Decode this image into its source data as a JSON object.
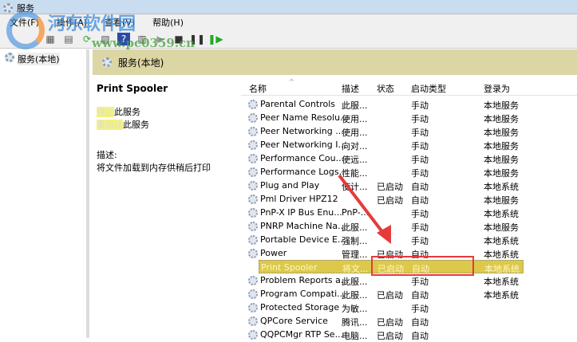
{
  "window": {
    "title": "服务"
  },
  "menu": [
    "文件(F)",
    "操作(A)",
    "查看(V)",
    "帮助(H)"
  ],
  "tree": {
    "item": "服务(本地)"
  },
  "band": {
    "title": "服务(本地)"
  },
  "details": {
    "service_name": "Print Spooler",
    "stop_link": "停止",
    "restart_link": "重启动",
    "link_suffix": "此服务",
    "desc_label": "描述:",
    "desc": "将文件加载到内存供稍后打印"
  },
  "columns": [
    "名称",
    "描述",
    "状态",
    "启动类型",
    "登录为"
  ],
  "rows": [
    [
      "Parental Controls",
      "此服...",
      "",
      "手动",
      "本地服务"
    ],
    [
      "Peer Name Resolu...",
      "使用...",
      "",
      "手动",
      "本地服务"
    ],
    [
      "Peer Networking ...",
      "使用...",
      "",
      "手动",
      "本地服务"
    ],
    [
      "Peer Networking I...",
      "向对...",
      "",
      "手动",
      "本地服务"
    ],
    [
      "Performance Cou...",
      "使远...",
      "",
      "手动",
      "本地服务"
    ],
    [
      "Performance Logs...",
      "性能...",
      "",
      "手动",
      "本地服务"
    ],
    [
      "Plug and Play",
      "使计...",
      "已启动",
      "自动",
      "本地系统"
    ],
    [
      "Pml Driver HPZ12",
      "",
      "已启动",
      "自动",
      "本地服务"
    ],
    [
      "PnP-X IP Bus Enu...",
      "PnP-...",
      "",
      "手动",
      "本地系统"
    ],
    [
      "PNRP Machine Na...",
      "此服...",
      "",
      "手动",
      "本地服务"
    ],
    [
      "Portable Device E...",
      "强制...",
      "",
      "手动",
      "本地系统"
    ],
    [
      "Power",
      "管理...",
      "已启动",
      "自动",
      "本地系统"
    ],
    [
      "Print Spooler",
      "将文...",
      "已启动",
      "自动",
      "本地系统"
    ],
    [
      "Problem Reports a...",
      "此服...",
      "",
      "手动",
      "本地系统"
    ],
    [
      "Program Compati...",
      "此服...",
      "已启动",
      "自动",
      "本地系统"
    ],
    [
      "Protected Storage",
      "为敏...",
      "",
      "手动",
      ""
    ],
    [
      "QPCore Service",
      "腾讯...",
      "已启动",
      "自动",
      ""
    ],
    [
      "QQPCMgr RTP Se...",
      "电脑...",
      "已启动",
      "自动",
      ""
    ]
  ],
  "selected_index": 12,
  "watermark": {
    "name": "河东软件园",
    "url": "www.pc0359.cn"
  }
}
